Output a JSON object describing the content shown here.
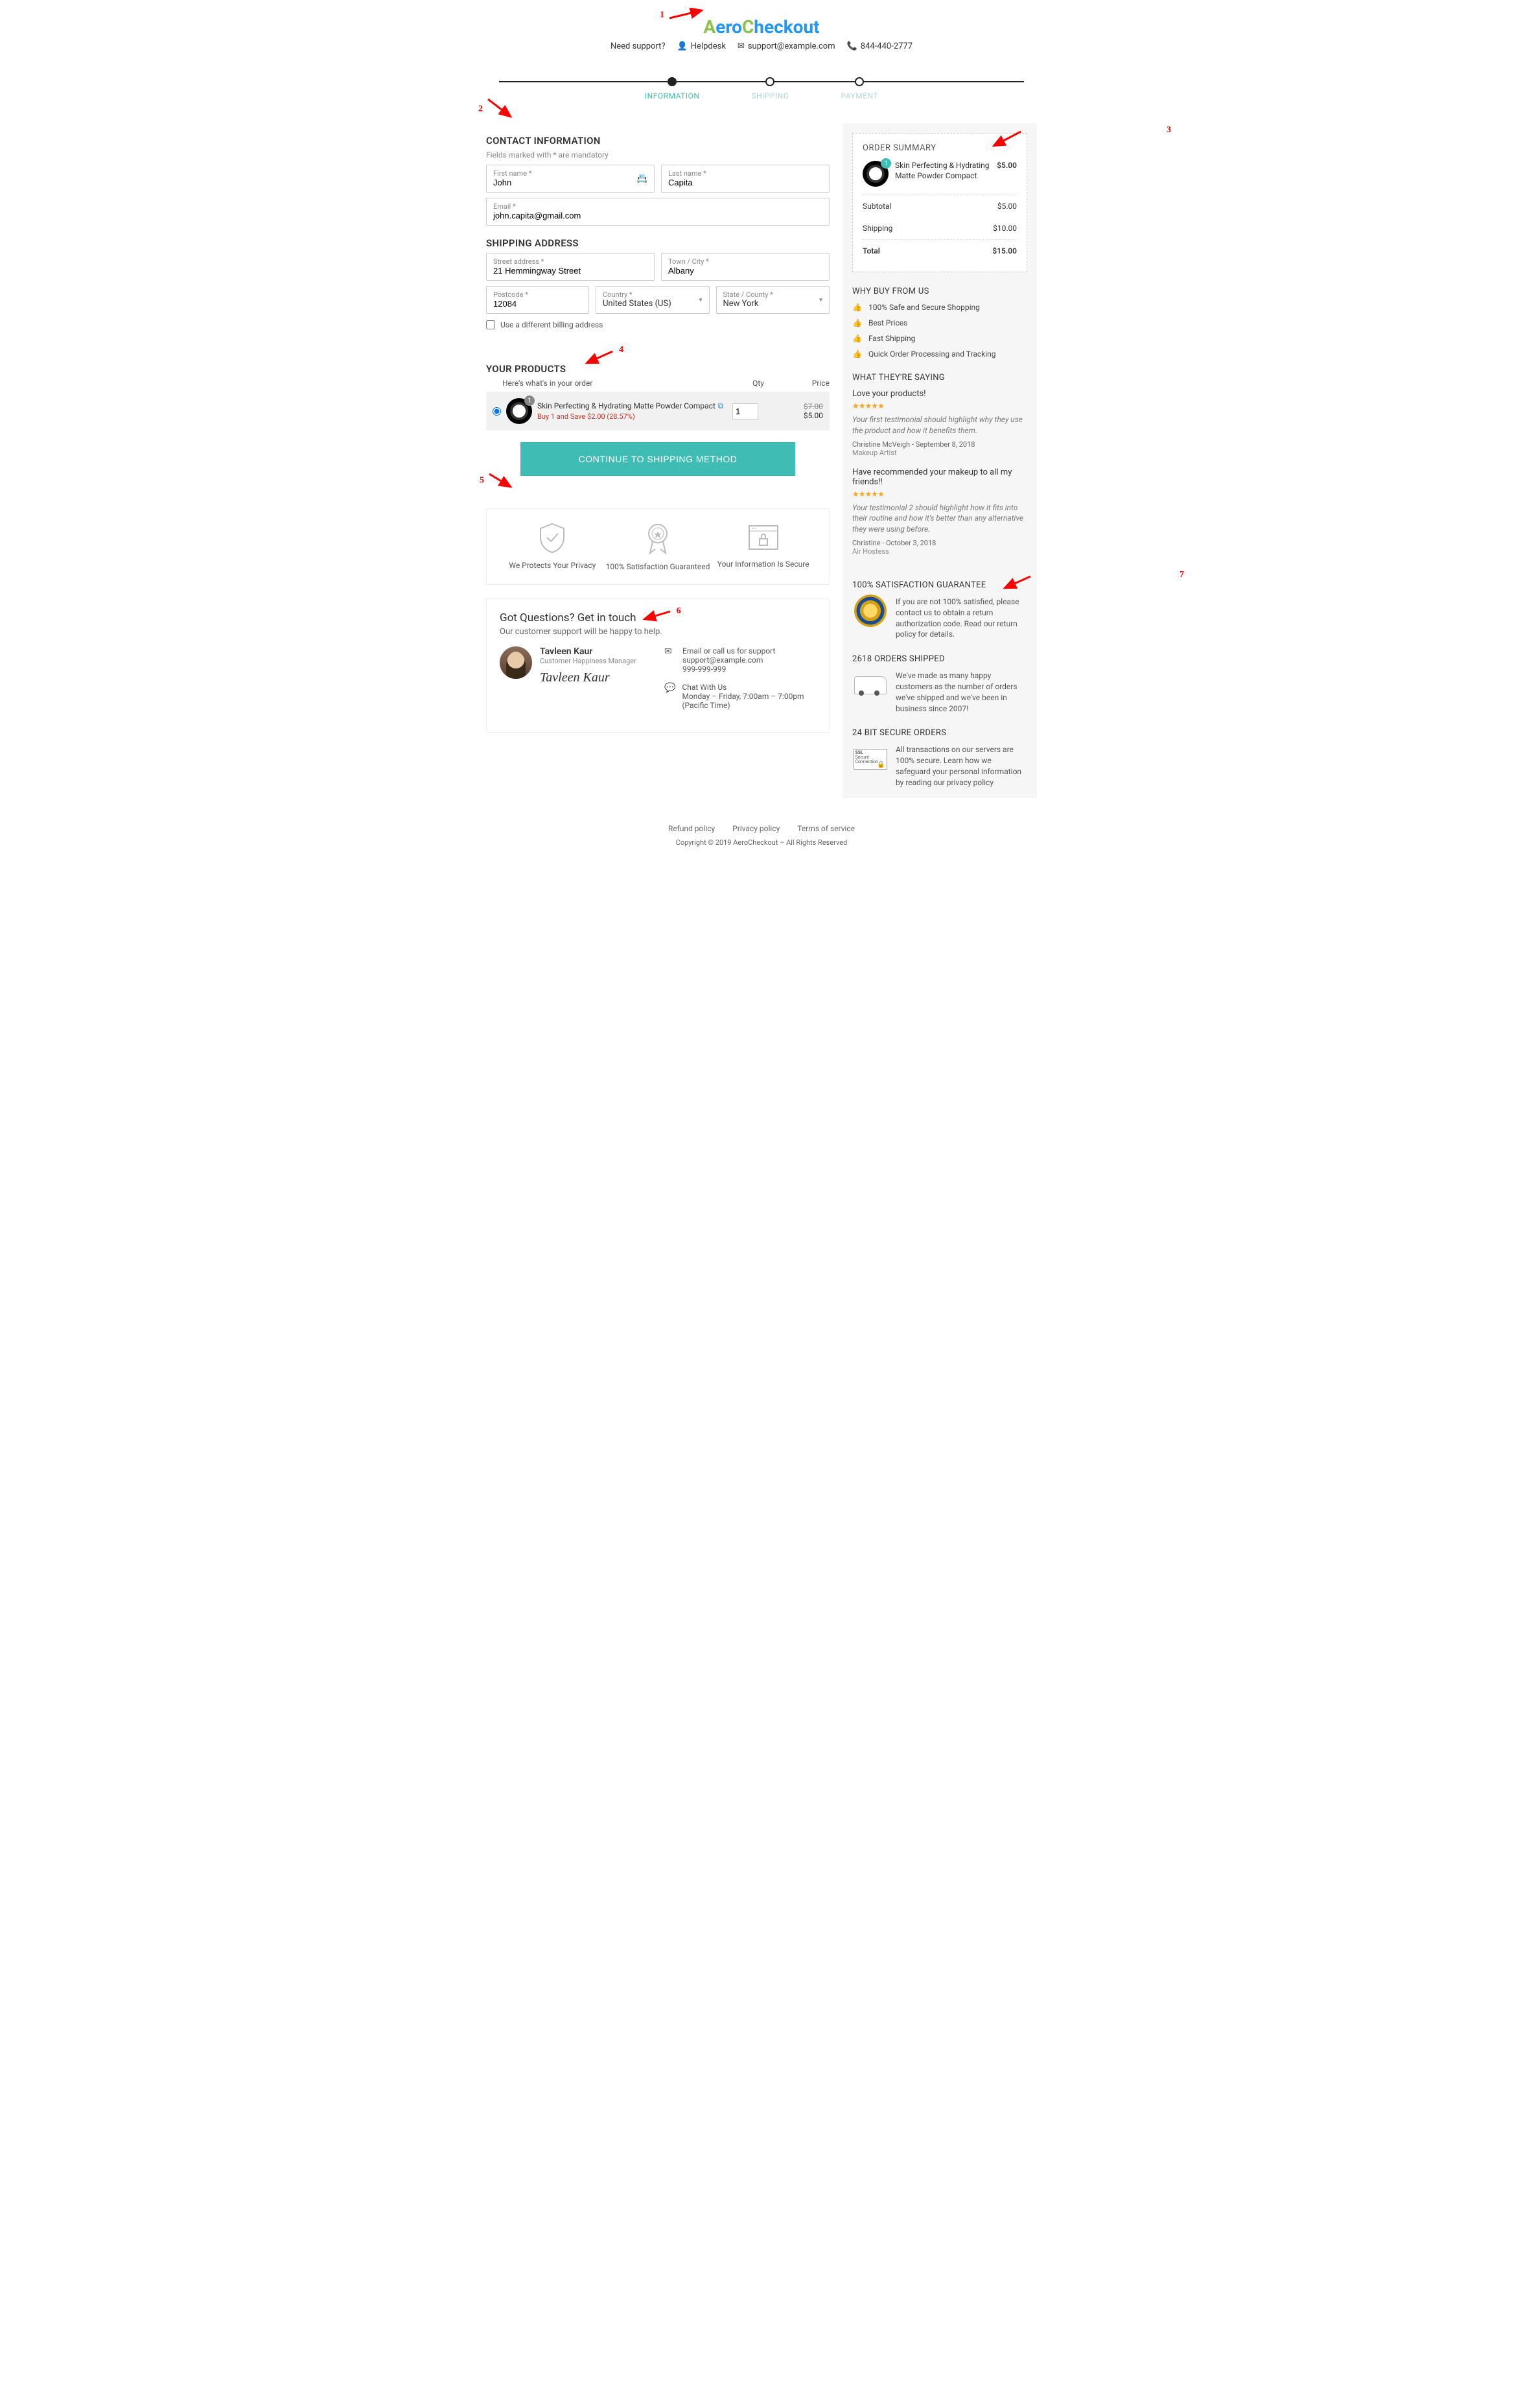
{
  "header": {
    "logo": "AeroCheckout",
    "need_support": "Need support?",
    "helpdesk": "Helpdesk",
    "email": "support@example.com",
    "phone": "844-440-2777"
  },
  "annotations": {
    "a1": "1",
    "a2": "2",
    "a3": "3",
    "a4": "4",
    "a5": "5",
    "a6": "6",
    "a7": "7"
  },
  "steps": {
    "info": "INFORMATION",
    "shipping": "SHIPPING",
    "payment": "PAYMENT"
  },
  "contact": {
    "title": "CONTACT INFORMATION",
    "note": "Fields marked with * are mandatory",
    "first_label": "First name *",
    "first_val": "John",
    "last_label": "Last name *",
    "last_val": "Capita",
    "email_label": "Email *",
    "email_val": "john.capita@gmail.com"
  },
  "ship": {
    "title": "SHIPPING ADDRESS",
    "street_label": "Street address *",
    "street_val": "21 Hemmingway Street",
    "city_label": "Town / City *",
    "city_val": "Albany",
    "post_label": "Postcode *",
    "post_val": "12084",
    "country_label": "Country *",
    "country_val": "United States (US)",
    "state_label": "State / County *",
    "state_val": "New York",
    "diff_billing": "Use a different billing address"
  },
  "products": {
    "title": "YOUR PRODUCTS",
    "intro": "Here's what's in your order",
    "col_qty": "Qty",
    "col_price": "Price",
    "item_name": "Skin Perfecting & Hydrating Matte Powder Compact",
    "item_badge": "1",
    "item_save": "Buy 1 and Save $2.00 (28.57%)",
    "item_qty": "1",
    "item_old": "$7.00",
    "item_new": "$5.00",
    "cta": "CONTINUE TO SHIPPING METHOD"
  },
  "trust": {
    "t1": "We Protects Your Privacy",
    "t2": "100% Satisfaction Guaranteed",
    "t3": "Your Information Is Secure"
  },
  "questions": {
    "title": "Got Questions? Get in touch",
    "sub": "Our customer support will be happy to help.",
    "name": "Tavleen Kaur",
    "role": "Customer Happiness Manager",
    "sig": "Tavleen Kaur",
    "c1_title": "Email or call us for support",
    "c1_email": "support@example.com",
    "c1_phone": "999-999-999",
    "c2_title": "Chat With Us",
    "c2_hours": "Monday – Friday, 7:00am – 7:00pm (Pacific Time)"
  },
  "summary": {
    "title": "ORDER SUMMARY",
    "item_name": "Skin Perfecting & Hydrating Matte Powder Compact",
    "item_badge": "1",
    "item_price": "$5.00",
    "sub_lbl": "Subtotal",
    "sub_val": "$5.00",
    "ship_lbl": "Shipping",
    "ship_val": "$10.00",
    "tot_lbl": "Total",
    "tot_val": "$15.00"
  },
  "why": {
    "title": "WHY BUY FROM US",
    "i1": "100% Safe and Secure Shopping",
    "i2": "Best Prices",
    "i3": "Fast Shipping",
    "i4": "Quick Order Processing and Tracking"
  },
  "testis": {
    "title": "WHAT THEY'RE SAYING",
    "t1_title": "Love your products!",
    "t1_body": "Your first testimonial should highlight why they use the product and how it benefits them.",
    "t1_author": "Christine McVeigh",
    "t1_date": "September 8, 2018",
    "t1_role": "Makeup Artist",
    "t2_title": "Have recommended your makeup to all my friends!!",
    "t2_body": "Your testimonial 2 should highlight how it fits into their routine and how it's better than any alternative they were using before.",
    "t2_author": "Christine",
    "t2_date": "October 3, 2018",
    "t2_role": "Air Hostess"
  },
  "guarantee": {
    "title": "100% SATISFACTION GUARANTEE",
    "body": "If you are not 100% satisfied, please contact us to obtain a return authorization code. Read our return policy for details."
  },
  "shipped": {
    "title": "2618 ORDERS SHIPPED",
    "body": "We've made as many happy customers as the number of orders we've shipped and we've been in business since 2007!"
  },
  "secure": {
    "title": "24 BIT SECURE ORDERS",
    "ssl_label": "SSL Secure Connection",
    "body": "All transactions on our servers are 100% secure. Learn how we safeguard your personal information by reading our privacy policy"
  },
  "footer": {
    "refund": "Refund policy",
    "privacy": "Privacy policy",
    "terms": "Terms of service",
    "copy": "Copyright © 2019 AeroCheckout – All Rights Reserved"
  }
}
